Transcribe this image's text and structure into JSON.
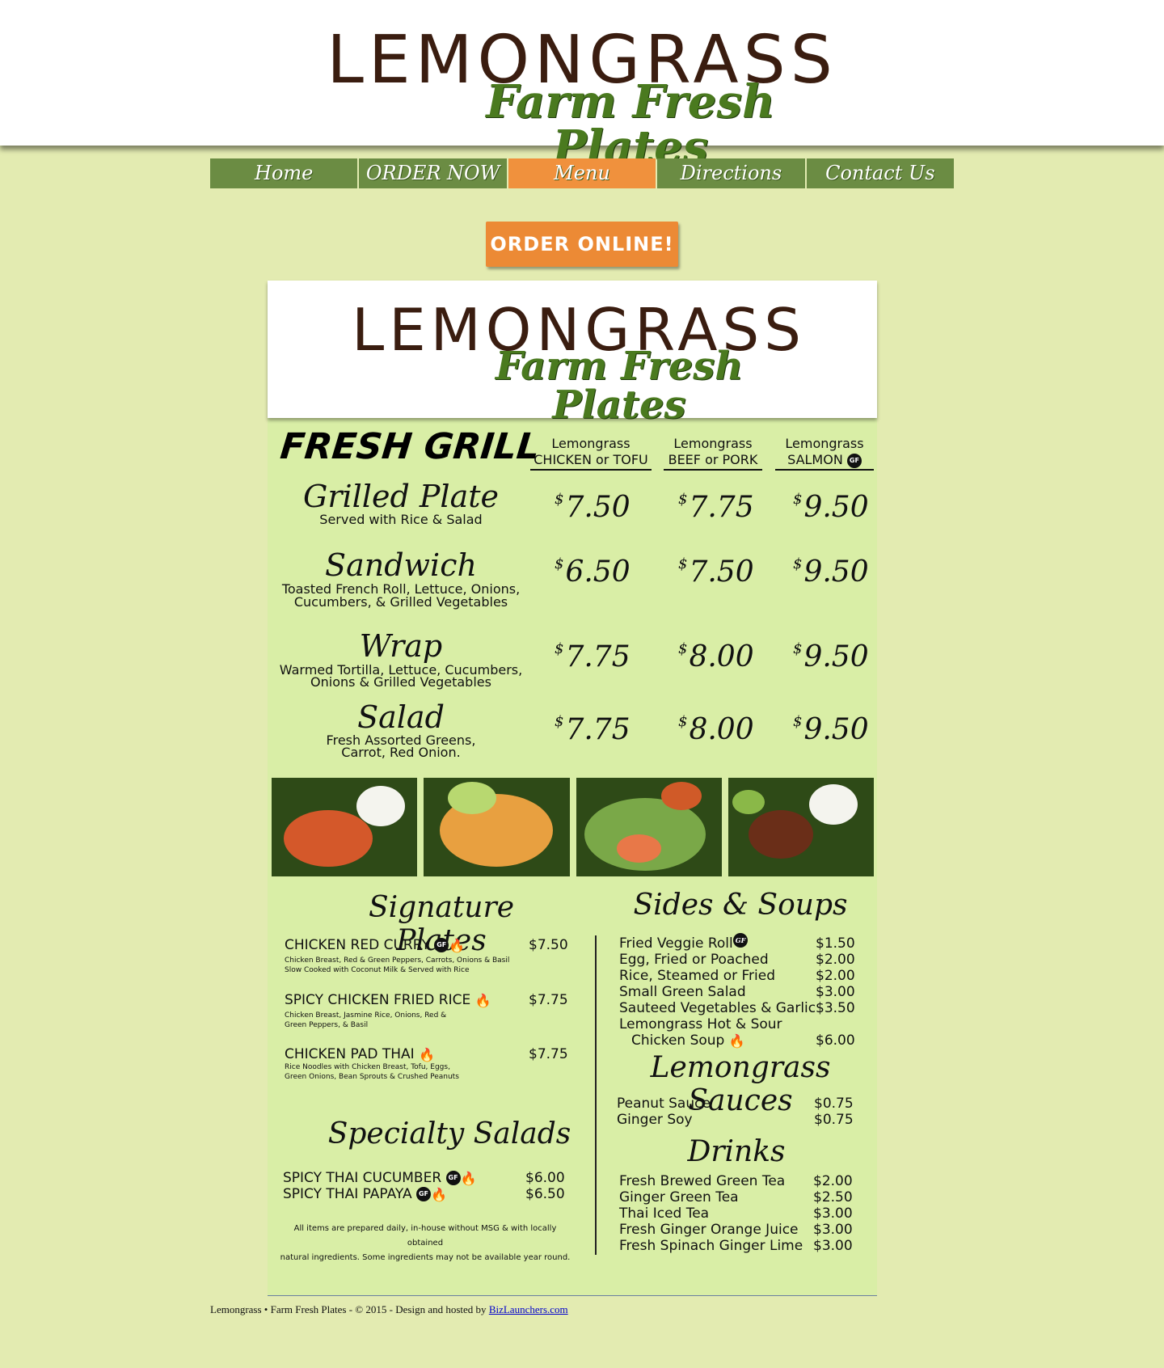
{
  "header": {
    "brand": "LEMONGRASS",
    "tagline": "Farm Fresh Plates"
  },
  "nav": [
    "Home",
    "ORDER NOW",
    "Menu",
    "Directions",
    "Contact Us"
  ],
  "order_button": "ORDER ONLINE!",
  "menu": {
    "brand": "LEMONGRASS",
    "tagline": "Farm Fresh Plates",
    "fresh_grill": {
      "title": "FRESH GRILL",
      "columns": [
        {
          "top": "Lemongrass",
          "sub": "CHICKEN or TOFU"
        },
        {
          "top": "Lemongrass",
          "sub": "BEEF or PORK"
        },
        {
          "top": "Lemongrass",
          "sub": "SALMON"
        }
      ],
      "gf_label": "GF",
      "items": [
        {
          "name": "Grilled Plate",
          "desc1": "Served with Rice & Salad",
          "desc2": "",
          "prices": [
            "7.50",
            "7.75",
            "9.50"
          ]
        },
        {
          "name": "Sandwich",
          "desc1": "Toasted French Roll, Lettuce, Onions,",
          "desc2": "Cucumbers,  & Grilled Vegetables",
          "prices": [
            "6.50",
            "7.50",
            "9.50"
          ]
        },
        {
          "name": "Wrap",
          "desc1": "Warmed Tortilla, Lettuce, Cucumbers,",
          "desc2": "Onions & Grilled Vegetables",
          "prices": [
            "7.75",
            "8.00",
            "9.50"
          ]
        },
        {
          "name": "Salad",
          "desc1": "Fresh Assorted Greens,",
          "desc2": "Carrot, Red Onion.",
          "prices": [
            "7.75",
            "8.00",
            "9.50"
          ]
        }
      ],
      "currency": "$"
    },
    "signature": {
      "title": "Signature Plates",
      "items": [
        {
          "name": "CHICKEN RED CURRY",
          "price": "$7.50",
          "desc1": "Chicken Breast, Red & Green Peppers, Carrots, Onions & Basil",
          "desc2": "Slow Cooked with Coconut Milk & Served with Rice"
        },
        {
          "name": "SPICY CHICKEN FRIED RICE",
          "price": "$7.75",
          "desc1": "Chicken Breast, Jasmine Rice, Onions, Red &",
          "desc2": "Green Peppers, & Basil"
        },
        {
          "name": "CHICKEN PAD THAI",
          "price": "$7.75",
          "desc1": "Rice Noodles with Chicken Breast, Tofu, Eggs,",
          "desc2": "Green Onions, Bean Sprouts & Crushed Peanuts"
        }
      ]
    },
    "salads": {
      "title": "Specialty Salads",
      "items": [
        {
          "name": "SPICY THAI CUCUMBER",
          "price": "$6.00"
        },
        {
          "name": "SPICY THAI PAPAYA",
          "price": "$6.50"
        }
      ],
      "note1": "All items are prepared daily, in-house without MSG & with locally obtained",
      "note2": "natural ingredients.  Some ingredients may not be available year round."
    },
    "sides": {
      "title": "Sides & Soups",
      "items": [
        {
          "name": "Fried Veggie Roll",
          "price": "$1.50"
        },
        {
          "name": "Egg, Fried or Poached",
          "price": "$2.00"
        },
        {
          "name": "Rice, Steamed or Fried",
          "price": "$2.00"
        },
        {
          "name": "Small Green Salad",
          "price": "$3.00"
        },
        {
          "name": "Sauteed Vegetables & Garlic",
          "price": "$3.50"
        },
        {
          "name": "Lemongrass Hot & Sour",
          "price": ""
        },
        {
          "name": "Chicken Soup",
          "price": "$6.00"
        }
      ]
    },
    "sauces": {
      "title": "Lemongrass Sauces",
      "items": [
        {
          "name": "Peanut Sauce",
          "price": "$0.75"
        },
        {
          "name": "Ginger Soy",
          "price": "$0.75"
        }
      ]
    },
    "drinks": {
      "title": "Drinks",
      "items": [
        {
          "name": "Fresh Brewed Green Tea",
          "price": "$2.00"
        },
        {
          "name": "Ginger Green Tea",
          "price": "$2.50"
        },
        {
          "name": "Thai Iced Tea",
          "price": "$3.00"
        },
        {
          "name": "Fresh Ginger Orange Juice",
          "price": "$3.00"
        },
        {
          "name": "Fresh Spinach Ginger Lime",
          "price": "$3.00"
        }
      ]
    }
  },
  "footer": {
    "text": "Lemongrass  • Farm Fresh Plates - © 2015 - Design and hosted by ",
    "link": "BizLaunchers.com"
  }
}
